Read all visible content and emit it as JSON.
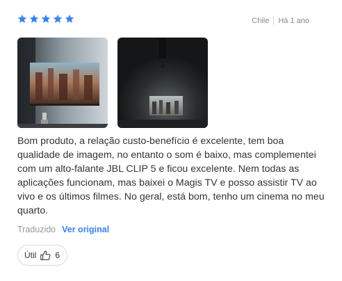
{
  "review": {
    "rating": 5,
    "max_rating": 5,
    "star_color": "#3483fa",
    "country": "Chile",
    "date": "Há 1 ano",
    "photos": [
      {
        "icon": "projector-screen-photo"
      },
      {
        "icon": "dark-room-projection-photo"
      }
    ],
    "text": "Bom produto, a relação custo-benefício é excelente, tem boa qualidade de imagem, no entanto o som é baixo, mas complementei com um alto-falante JBL CLIP 5 e ficou excelente. Nem todas as aplicações funcionam, mas baixei o Magis TV e posso assistir TV ao vivo e os últimos filmes. No geral, está bom, tenho um cinema no meu quarto.",
    "translated_label": "Traduzido",
    "view_original_label": "Ver original",
    "useful_label": "Útil",
    "useful_count": "6",
    "link_color": "#3483fa"
  }
}
